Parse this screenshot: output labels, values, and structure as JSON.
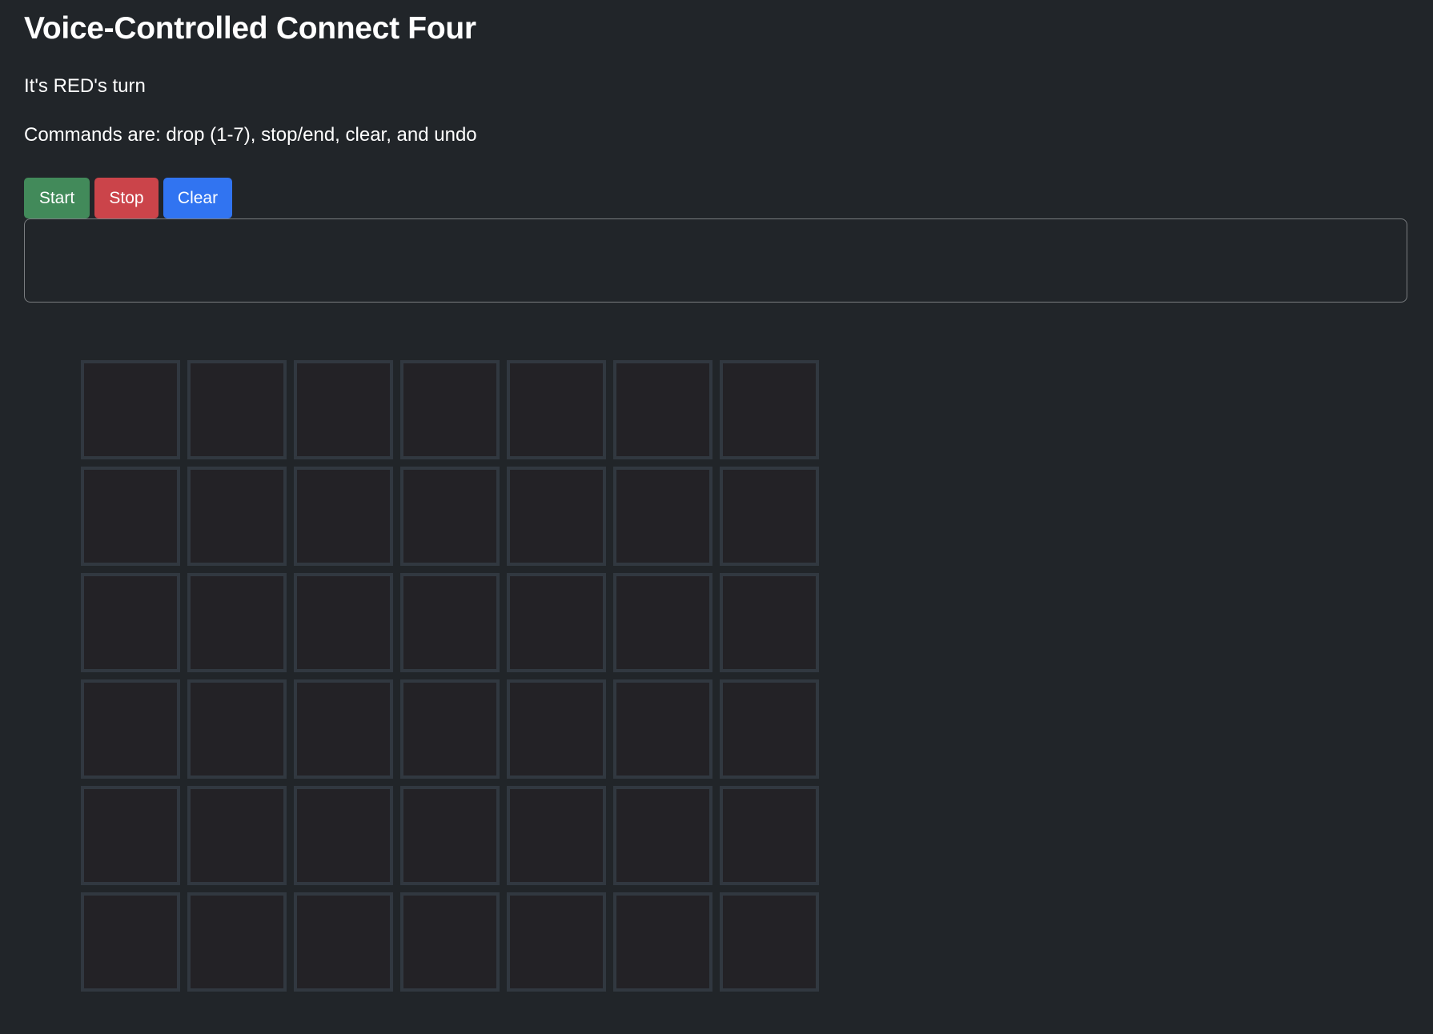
{
  "title": "Voice-Controlled Connect Four",
  "turn_text": "It's RED's turn",
  "commands_text": "Commands are: drop (1-7), stop/end, clear, and undo",
  "buttons": {
    "start": "Start",
    "stop": "Stop",
    "clear": "Clear"
  },
  "transcript": {
    "value": ""
  },
  "board": {
    "rows": 6,
    "columns": 7,
    "cells": "all empty"
  },
  "colors": {
    "start": "#428a5a",
    "stop": "#cb444a",
    "clear": "#3174f1",
    "background": "#212529"
  }
}
